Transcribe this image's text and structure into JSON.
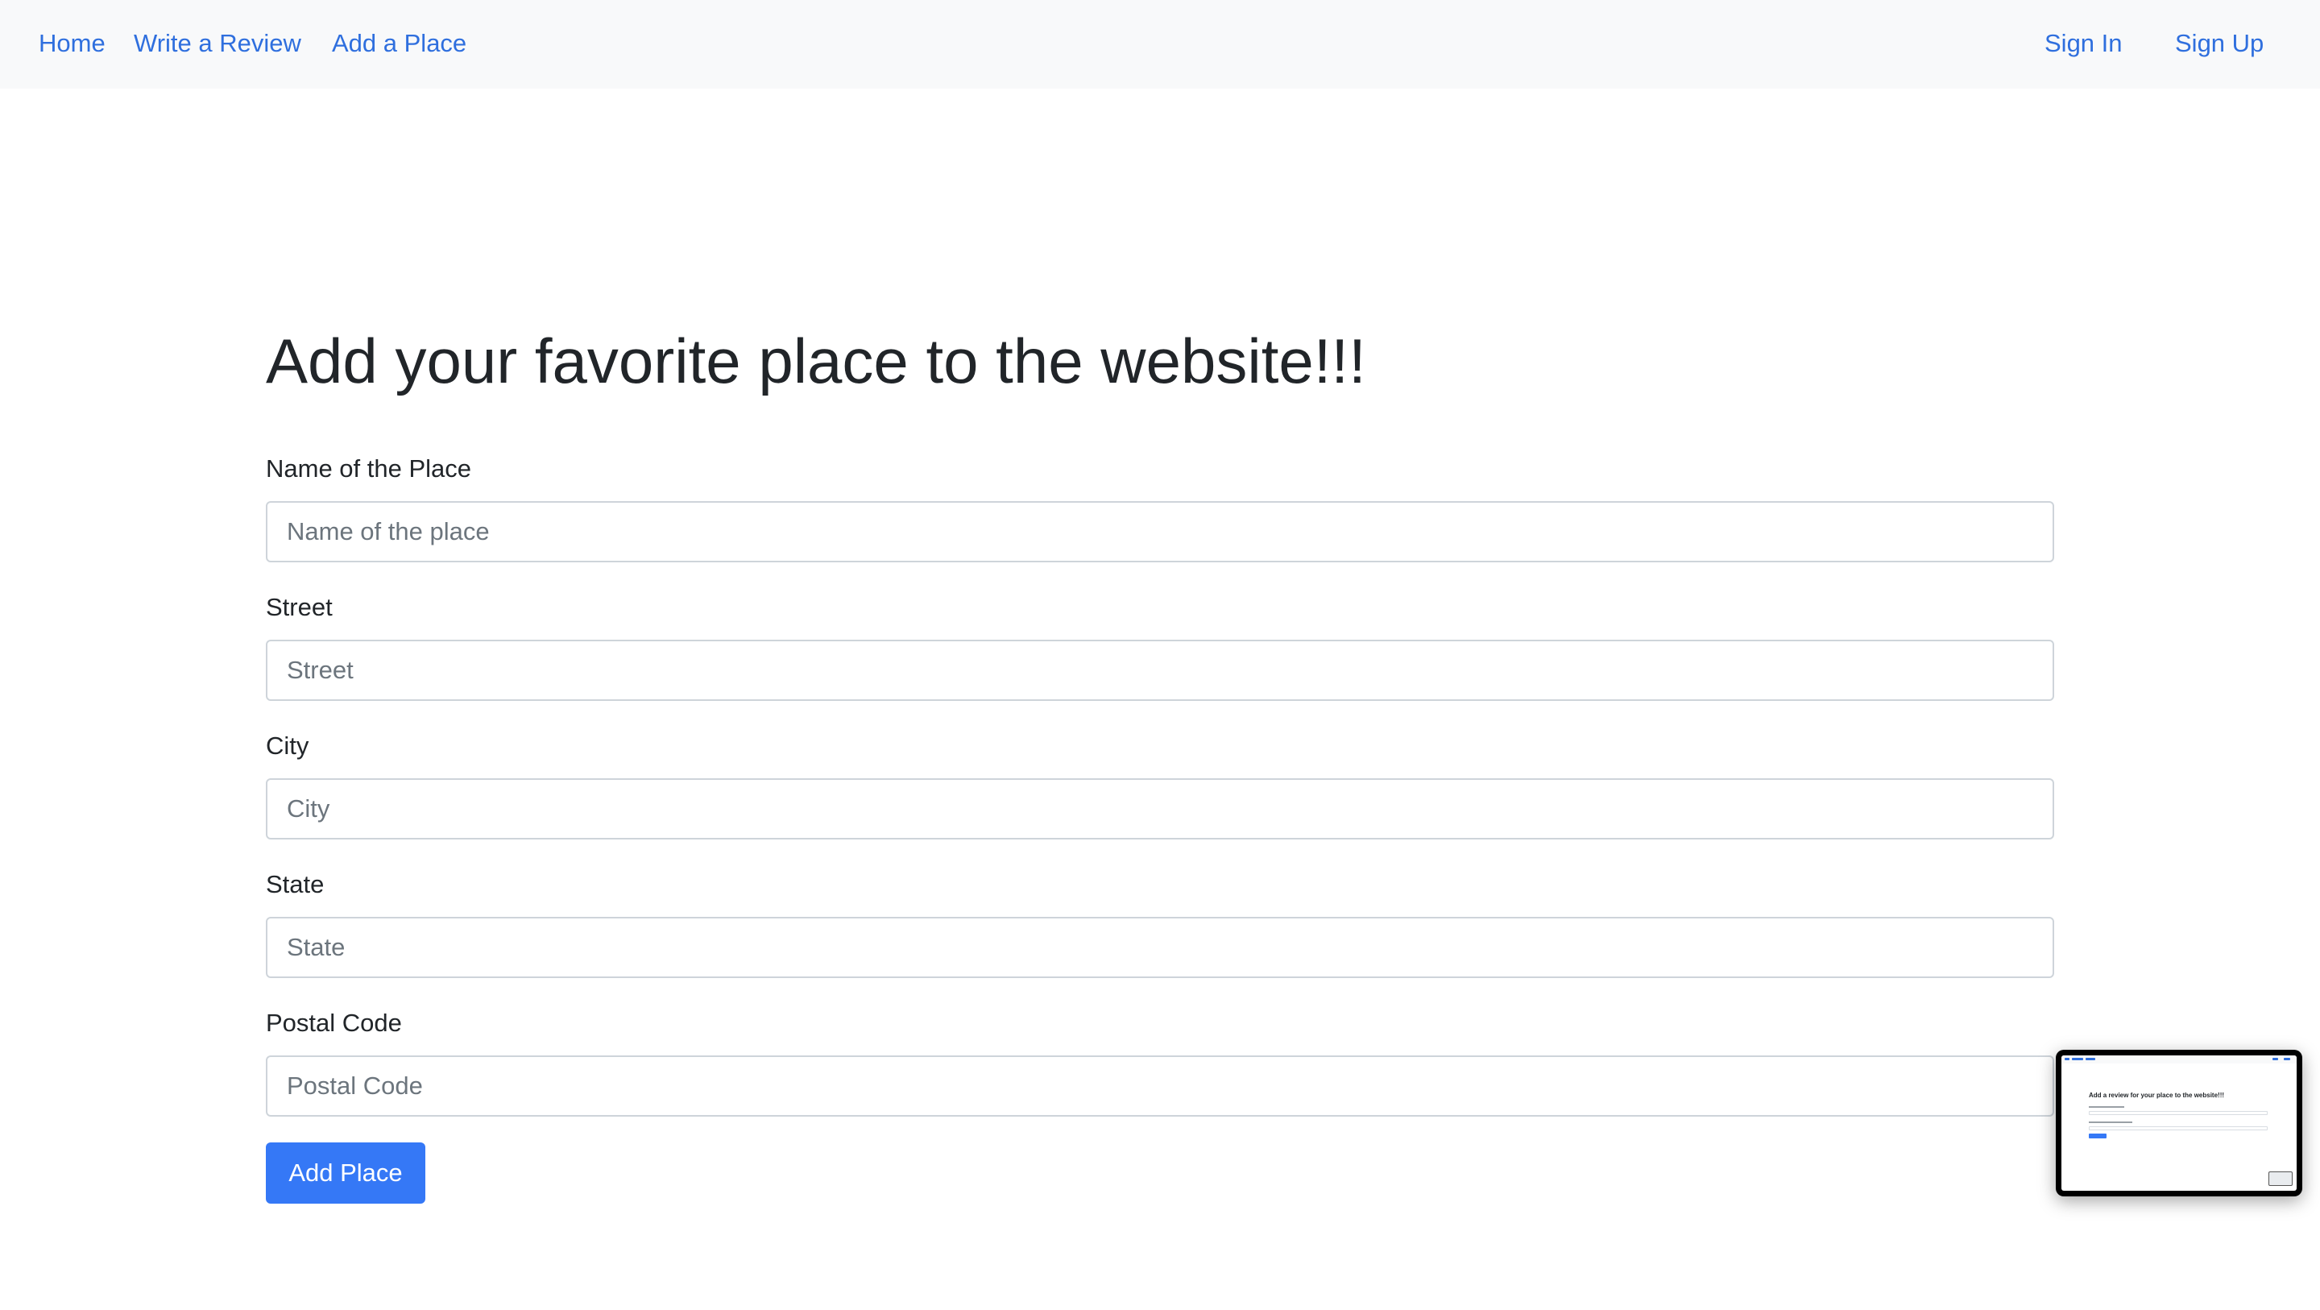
{
  "nav": {
    "home": "Home",
    "write_review": "Write a Review",
    "add_place": "Add a Place",
    "sign_in": "Sign In",
    "sign_up": "Sign Up"
  },
  "main": {
    "title": "Add your favorite place to the website!!!",
    "fields": [
      {
        "label": "Name of the Place",
        "placeholder": "Name of the place",
        "value": ""
      },
      {
        "label": "Street",
        "placeholder": "Street",
        "value": ""
      },
      {
        "label": "City",
        "placeholder": "City",
        "value": ""
      },
      {
        "label": "State",
        "placeholder": "State",
        "value": ""
      },
      {
        "label": "Postal Code",
        "placeholder": "Postal Code",
        "value": ""
      }
    ],
    "submit_label": "Add Place"
  },
  "preview": {
    "title": "Add a review for your place to the website!!!"
  },
  "colors": {
    "link": "#2f6fde",
    "primary": "#3578f6",
    "navbar_bg": "#f8f9fa",
    "text": "#212529",
    "placeholder": "#6c757d",
    "border": "#ced4da"
  }
}
